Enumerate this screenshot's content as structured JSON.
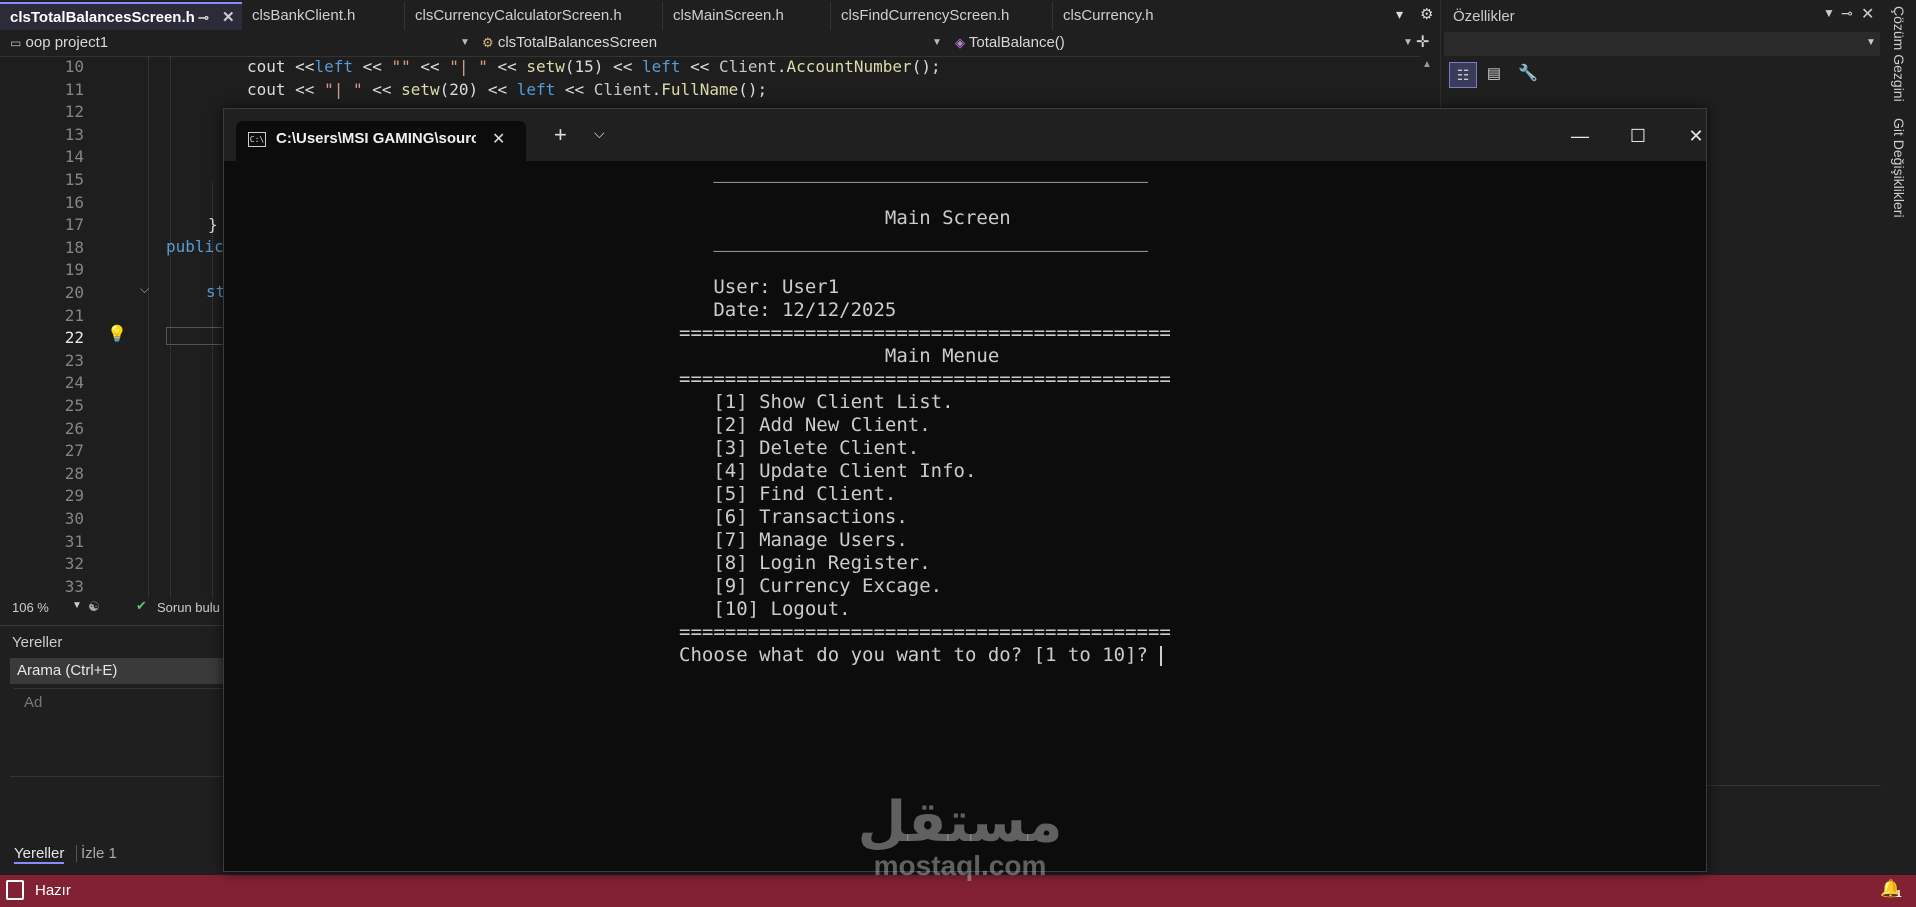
{
  "ide": {
    "tabs": [
      {
        "label": "clsTotalBalancesScreen.h",
        "active": true
      },
      {
        "label": "clsBankClient.h"
      },
      {
        "label": "clsCurrencyCalculatorScreen.h"
      },
      {
        "label": "clsMainScreen.h"
      },
      {
        "label": "clsFindCurrencyScreen.h"
      },
      {
        "label": "clsCurrency.h"
      }
    ],
    "nav": {
      "project": "oop project1",
      "class": "clsTotalBalancesScreen",
      "member": "TotalBalance()"
    },
    "line_numbers": [
      "10",
      "11",
      "12",
      "13",
      "14",
      "15",
      "16",
      "17",
      "18",
      "19",
      "20",
      "21",
      "22",
      "23",
      "24",
      "25",
      "26",
      "27",
      "28",
      "29",
      "30",
      "31",
      "32",
      "33"
    ],
    "current_line": "22",
    "code": {
      "line10": {
        "p1": "cout <<",
        "p2": "left",
        "p3": " << ",
        "p4": "\"\"",
        "p5": " << ",
        "p6": "\"| \"",
        "p7": " << ",
        "p8": "setw",
        "p9": "(15) << ",
        "p10": "left",
        "p11": " << ",
        "p12": "Client",
        "p13": ".",
        "p14": "AccountNumber",
        "p15": "();"
      },
      "line11": {
        "p1": "cout << ",
        "p2": "\"| \"",
        "p3": " << ",
        "p4": "setw",
        "p5": "(20) << ",
        "p6": "left",
        "p7": " << ",
        "p8": "Client",
        "p9": ".",
        "p10": "FullName",
        "p11": "();"
      },
      "line18": "public",
      "line20": "st"
    },
    "zoom": "106 %",
    "issues": "Sorun bulu",
    "locals_panel": {
      "title": "Yereller",
      "search": "Arama (Ctrl+E)",
      "column": "Ad",
      "bottom_tabs": [
        "Yereller",
        "İzle 1"
      ]
    },
    "properties_panel": {
      "title": "Özellikler"
    },
    "side_tabs": [
      "Çözüm Gezgini",
      "Git Değişiklikleri"
    ],
    "status": "Hazır",
    "notification_count": "1"
  },
  "terminal": {
    "tab_title": "C:\\Users\\MSI GAMING\\source",
    "lines": [
      "   ______________________________________",
      "",
      "                  Main Screen",
      "   ______________________________________",
      "",
      "   User: User1",
      "   Date: 12/12/2025",
      "===========================================",
      "                  Main Menue",
      "===========================================",
      "   [1] Show Client List.",
      "   [2] Add New Client.",
      "   [3] Delete Client.",
      "   [4] Update Client Info.",
      "   [5] Find Client.",
      "   [6] Transactions.",
      "   [7] Manage Users.",
      "   [8] Login Register.",
      "   [9] Currency Excage.",
      "   [10] Logout.",
      "===========================================",
      "Choose what do you want to do? [1 to 10]? "
    ]
  },
  "watermark": {
    "arabic": "مستقل",
    "latin": "mostaql.com"
  },
  "colors": {
    "accent_status": "#822133",
    "terminal_bg": "#0c0c0c",
    "keyword": "#569cd6",
    "function": "#dcdcaa"
  }
}
